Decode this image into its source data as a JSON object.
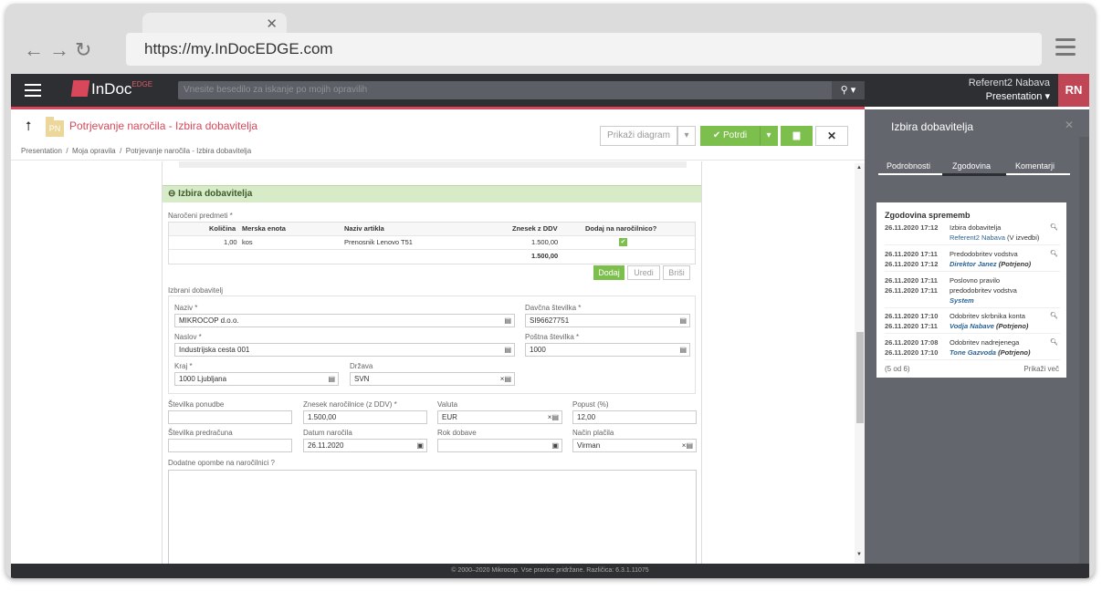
{
  "browser": {
    "url": "https://my.InDocEDGE.com",
    "tab_close": "✕"
  },
  "app": {
    "logo": "InDoc",
    "logo_sup": "EDGE",
    "search_placeholder": "Vnesite besedilo za iskanje po mojih opravilih",
    "user_name": "Referent2 Nabava",
    "user_env": "Presentation ▾",
    "avatar": "RN"
  },
  "header": {
    "pn": "PN",
    "title": "Potrjevanje naročila - Izbira dobavitelja",
    "breadcrumb": [
      "Presentation",
      "Moja opravila",
      "Potrjevanje naročila - Izbira dobavitelja"
    ],
    "btn_diagram": "Prikaži diagram",
    "btn_confirm": "Potrdi"
  },
  "section": {
    "title": "Izbira dobavitelja",
    "items_label": "Naročeni predmeti *",
    "columns": [
      "Količina",
      "Merska enota",
      "Naziv artikla",
      "Znesek z DDV",
      "Dodaj na naročilnico?"
    ],
    "rows": [
      {
        "qty": "1,00",
        "unit": "kos",
        "name": "Prenosnik Lenovo T51",
        "amount": "1.500,00"
      }
    ],
    "total": "1.500,00",
    "btn_add": "Dodaj",
    "btn_edit": "Uredi",
    "btn_delete": "Briši",
    "supplier_label": "Izbrani dobavitelj",
    "naziv_label": "Naziv *",
    "naziv": "MIKROCOP d.o.o.",
    "davcna_label": "Davčna številka *",
    "davcna": "SI96627751",
    "naslov_label": "Naslov *",
    "naslov": "Industrijska cesta 001",
    "postna_label": "Poštna številka *",
    "postna": "1000",
    "kraj_label": "Kraj *",
    "kraj": "1000 Ljubljana",
    "drzava_label": "Država",
    "drzava": "SVN",
    "ponudba_label": "Številka ponudbe",
    "ponudba": "",
    "znesek_label": "Znesek naročilnice (z DDV) *",
    "znesek": "1.500,00",
    "valuta_label": "Valuta",
    "valuta": "EUR",
    "popust_label": "Popust (%)",
    "popust": "12,00",
    "predracun_label": "Številka predračuna",
    "predracun": "",
    "datum_label": "Datum naročila",
    "datum": "26.11.2020",
    "rok_label": "Rok dobave",
    "rok": "",
    "placilo_label": "Način plačila",
    "placilo": "Virman",
    "opombe_label": "Dodatne opombe na naročilnici  ?"
  },
  "footer": "© 2000–2020 Mikrocop. Vse pravice pridržane. Različica: 6.3.1.11075",
  "panel": {
    "title": "Izbira dobavitelja",
    "tabs": [
      "Podrobnosti",
      "Zgodovina",
      "Komentarji"
    ],
    "history_title": "Zgodovina sprememb",
    "history": [
      {
        "d1": "26.11.2020 17:12",
        "t1": "Izbira dobavitelja",
        "d2": "",
        "t2": "Referent2 Nabava",
        "t2b": " (V izvedbi)"
      },
      {
        "d1": "26.11.2020 17:11",
        "t1": "Predodobritev vodstva",
        "d2": "26.11.2020 17:12",
        "t2": "Direktor Janez",
        "t2b": " (Potrjeno)"
      },
      {
        "d1": "26.11.2020 17:11",
        "t1": "Poslovno pravilo",
        "d2": "26.11.2020 17:11",
        "t2": "predodobritev vodstva",
        "t3": "System"
      },
      {
        "d1": "26.11.2020 17:10",
        "t1": "Odobritev skrbnika konta",
        "d2": "26.11.2020 17:11",
        "t2": "Vodja Nabave",
        "t2b": " (Potrjeno)"
      },
      {
        "d1": "26.11.2020 17:08",
        "t1": "Odobritev nadrejenega",
        "d2": "26.11.2020 17:10",
        "t2": "Tone Gazvoda",
        "t2b": " (Potrjeno)"
      }
    ],
    "count": "(5 od 6)",
    "more": "Prikaži več"
  }
}
